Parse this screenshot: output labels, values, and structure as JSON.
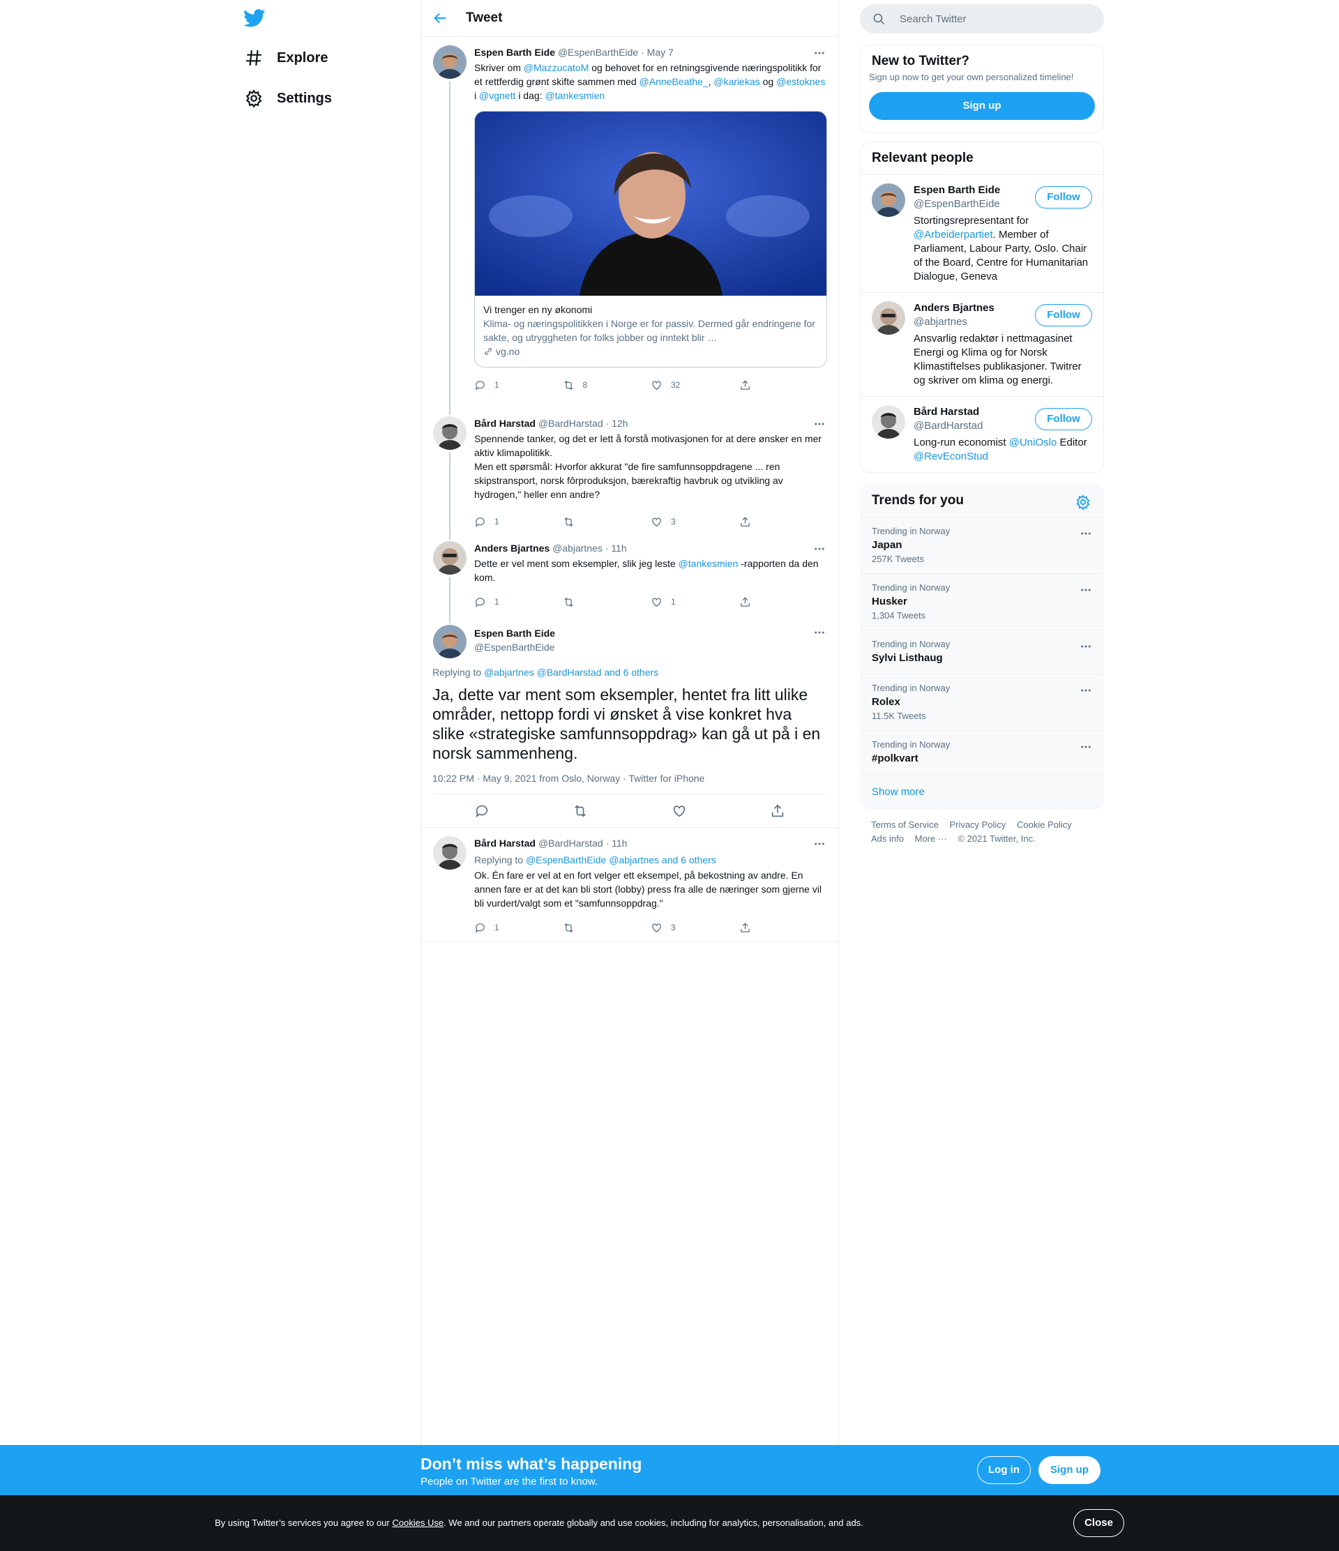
{
  "nav": {
    "explore": "Explore",
    "settings": "Settings"
  },
  "header": {
    "title": "Tweet"
  },
  "tweets": [
    {
      "name": "Espen Barth Eide",
      "handle": "@EspenBarthEide",
      "sep": "·",
      "time": "May 7",
      "text": {
        "t1": "Skriver om ",
        "m1": "@MazzucatoM",
        "t2": " og behovet for en retningsgivende næringspolitikk for et rettferdig grønt skifte sammen med ",
        "m2": "@AnneBeathe_",
        "t3": ", ",
        "m3": "@kariekas",
        "t4": " og ",
        "m4": "@estoknes",
        "t5": " i  ",
        "m5": "@vgnett",
        "t6": " i dag: ",
        "m6": "@tankesmien"
      },
      "card": {
        "title": "Vi trenger en ny økonomi",
        "desc": "Klima- og næringspolitikken i Norge er for passiv. Dermed går endringene for sakte, og utryggheten for folks jobber og inntekt blir …",
        "domain": "vg.no"
      },
      "replies": "1",
      "retweets": "8",
      "likes": "32"
    },
    {
      "name": "Bård Harstad",
      "handle": "@BardHarstad",
      "sep": "·",
      "time": "12h",
      "text_lines": [
        "Spennende tanker, og det er lett å forstå motivasjonen for at dere ønsker en mer aktiv klimapolitikk.",
        "Men ett spørsmål: Hvorfor akkurat \"de fire samfunnsoppdragene ... ren skipstransport, norsk fôrproduksjon, bærekraftig havbruk og utvikling av hydrogen,\" heller enn andre?"
      ],
      "replies": "1",
      "retweets": "",
      "likes": "3"
    },
    {
      "name": "Anders Bjartnes",
      "handle": "@abjartnes",
      "sep": "·",
      "time": "11h",
      "text": {
        "t1": "Dette er vel ment som eksempler, slik jeg leste ",
        "m1": "@tankesmien",
        "t2": " -rapporten da den kom."
      },
      "replies": "1",
      "retweets": "",
      "likes": "1"
    }
  ],
  "main_tweet": {
    "name": "Espen Barth Eide",
    "handle": "@EspenBarthEide",
    "replying_to_label": "Replying to",
    "replying_to": "@abjartnes @BardHarstad and 6 others",
    "text": "Ja, dette var ment som eksempler, hentet fra litt ulike områder, nettopp fordi vi ønsket å vise konkret hva slike  «strategiske samfunnsoppdrag» kan gå ut på i en norsk sammenheng.",
    "timestamp": "10:22 PM · May 9, 2021 from Oslo, Norway · Twitter for iPhone"
  },
  "reply": {
    "name": "Bård Harstad",
    "handle": "@BardHarstad",
    "sep": "·",
    "time": "11h",
    "replying_to_label": "Replying to",
    "replying_to": "@EspenBarthEide @abjartnes and 6 others",
    "text": "Ok. Én fare er vel at en fort velger ett eksempel, på bekostning av andre. En annen fare er at det kan bli stort (lobby) press fra alle de næringer som gjerne vil bli vurdert/valgt som et \"samfunnsoppdrag.\"",
    "replies": "1",
    "retweets": "",
    "likes": "3"
  },
  "sidebar": {
    "search_placeholder": "Search Twitter",
    "new_to_twitter": {
      "title": "New to Twitter?",
      "subtitle": "Sign up now to get your own personalized timeline!",
      "button": "Sign up"
    },
    "relevant_people": {
      "title": "Relevant people",
      "follow_label": "Follow",
      "people": [
        {
          "name": "Espen Barth Eide",
          "handle": "@EspenBarthEide",
          "bio_t1": "Stortingsrepresentant for ",
          "bio_m1": "@Arbeiderpartiet",
          "bio_t2": ". Member of Parliament, Labour Party, Oslo. Chair of the Board, Centre for Humanitarian Dialogue, Geneva"
        },
        {
          "name": "Anders Bjartnes",
          "handle": "@abjartnes",
          "bio_t1": "Ansvarlig redaktør i nettmagasinet Energi og Klima og for Norsk Klimastiftelses publikasjoner. Twitrer og skriver om klima og energi."
        },
        {
          "name": "Bård Harstad",
          "handle": "@BardHarstad",
          "bio_t1": "Long-run economist ",
          "bio_m1": "@UniOslo",
          "bio_t2": " Editor ",
          "bio_m2": "@RevEconStud"
        }
      ]
    },
    "trends": {
      "title": "Trends for you",
      "items": [
        {
          "context": "Trending in Norway",
          "name": "Japan",
          "count": "257K Tweets"
        },
        {
          "context": "Trending in Norway",
          "name": "Husker",
          "count": "1,304 Tweets"
        },
        {
          "context": "Trending in Norway",
          "name": "Sylvi Listhaug",
          "count": ""
        },
        {
          "context": "Trending in Norway",
          "name": "Rolex",
          "count": "11.5K Tweets"
        },
        {
          "context": "Trending in Norway",
          "name": "#polkvart",
          "count": ""
        }
      ],
      "show_more": "Show more"
    },
    "footer": {
      "terms": "Terms of Service",
      "privacy": "Privacy Policy",
      "cookie": "Cookie Policy",
      "ads": "Ads info",
      "more": "More ···",
      "copyright": "© 2021 Twitter, Inc."
    }
  },
  "promo": {
    "title": "Don’t miss what’s happening",
    "subtitle": "People on Twitter are the first to know.",
    "login": "Log in",
    "signup": "Sign up"
  },
  "cookie": {
    "t1": "By using Twitter’s services you agree to our ",
    "link": "Cookies Use",
    "t2": ". We and our partners operate globally and use cookies, including for analytics, personalisation, and ads.",
    "close": "Close"
  },
  "colors": {
    "accent": "#1da1f2",
    "link": "#1b95e0",
    "muted": "#5b7083",
    "border": "#ebeef0",
    "dark": "#14171a"
  }
}
